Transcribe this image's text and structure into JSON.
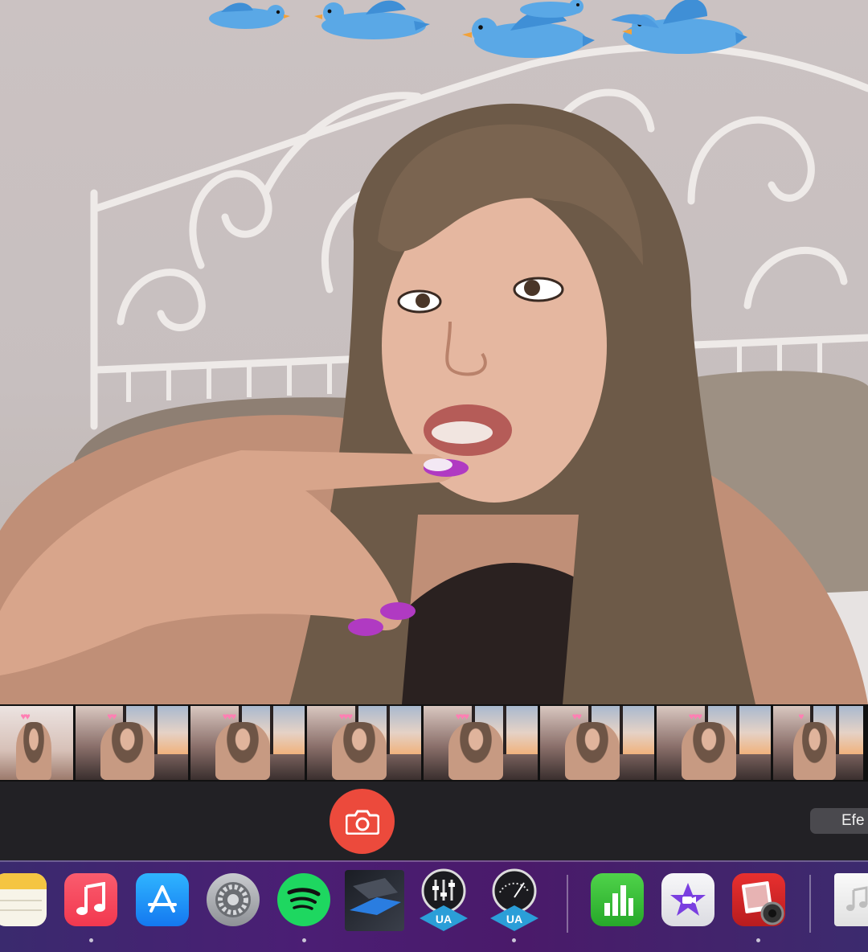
{
  "camera": {
    "shutter_icon": "camera-icon",
    "effects_label": "Efe"
  },
  "thumbnails": {
    "count": 8
  },
  "dock": {
    "apps": [
      {
        "name": "notes",
        "icon": "notes-icon",
        "running": false
      },
      {
        "name": "music",
        "icon": "music-icon",
        "running": true
      },
      {
        "name": "app-store",
        "icon": "app-store-icon",
        "running": false
      },
      {
        "name": "system-preferences",
        "icon": "gear-icon",
        "running": false
      },
      {
        "name": "spotify",
        "icon": "spotify-icon",
        "running": true
      },
      {
        "name": "dark-app",
        "icon": "dark-app-icon",
        "running": false
      },
      {
        "name": "uad-console",
        "icon": "uad-console-icon",
        "running": false
      },
      {
        "name": "uad-meter",
        "icon": "uad-meter-icon",
        "running": true
      },
      {
        "name": "numbers",
        "icon": "numbers-icon",
        "running": false
      },
      {
        "name": "imovie",
        "icon": "imovie-icon",
        "running": false
      },
      {
        "name": "photo-booth",
        "icon": "photo-booth-icon",
        "running": true
      },
      {
        "name": "music-file",
        "icon": "music-file-icon",
        "running": false
      }
    ]
  },
  "colors": {
    "shutter": "#ec4a3c",
    "control_bar": "#222125",
    "dock_gradient_start": "#3a2a6e",
    "dock_gradient_end": "#4a1a6a"
  }
}
